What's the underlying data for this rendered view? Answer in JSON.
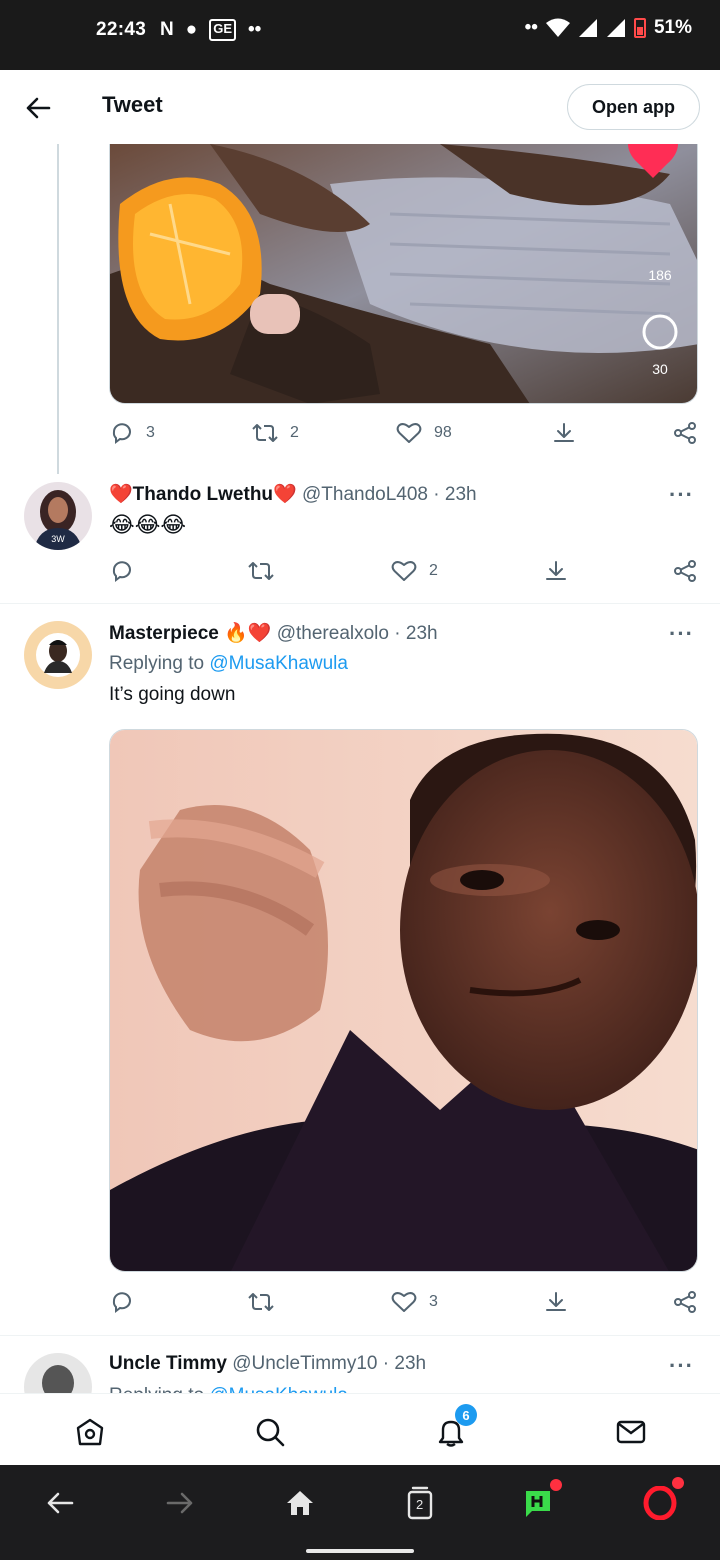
{
  "status_bar": {
    "time": "22:43",
    "left_icons": [
      "N",
      "●",
      "GE",
      "••"
    ],
    "battery": "51%"
  },
  "header": {
    "title": "Tweet",
    "open_app_label": "Open app"
  },
  "first_tweet_actions": {
    "replies": "3",
    "retweets": "2",
    "likes": "98"
  },
  "first_media_overlay": {
    "likes": "186",
    "comments": "30"
  },
  "tweets": [
    {
      "name": "Thando Lwethu",
      "name_emoji_before": "❤️",
      "name_emoji_after": "❤️",
      "handle": "@ThandoL408",
      "time": "23h",
      "text": "😂😂😂",
      "likes": "2"
    },
    {
      "name": "Masterpiece",
      "name_emoji_after": "🔥❤️",
      "handle": "@therealxolo",
      "time": "23h",
      "replying_label": "Replying to",
      "replying_to": "@MusaKhawula",
      "text": "It’s going down",
      "likes": "3"
    },
    {
      "name": "Uncle Timmy",
      "handle": "@UncleTimmy10",
      "time": "23h",
      "replying_label": "Replying to",
      "replying_to": "@MusaKhawula"
    }
  ],
  "bottom_nav": {
    "notifications_badge": "6"
  },
  "browser_bar": {
    "tabs_count": "2"
  },
  "colors": {
    "accent": "#1d9bf0",
    "text": "#0f1419",
    "muted": "#536471",
    "heart": "#e0245e"
  }
}
